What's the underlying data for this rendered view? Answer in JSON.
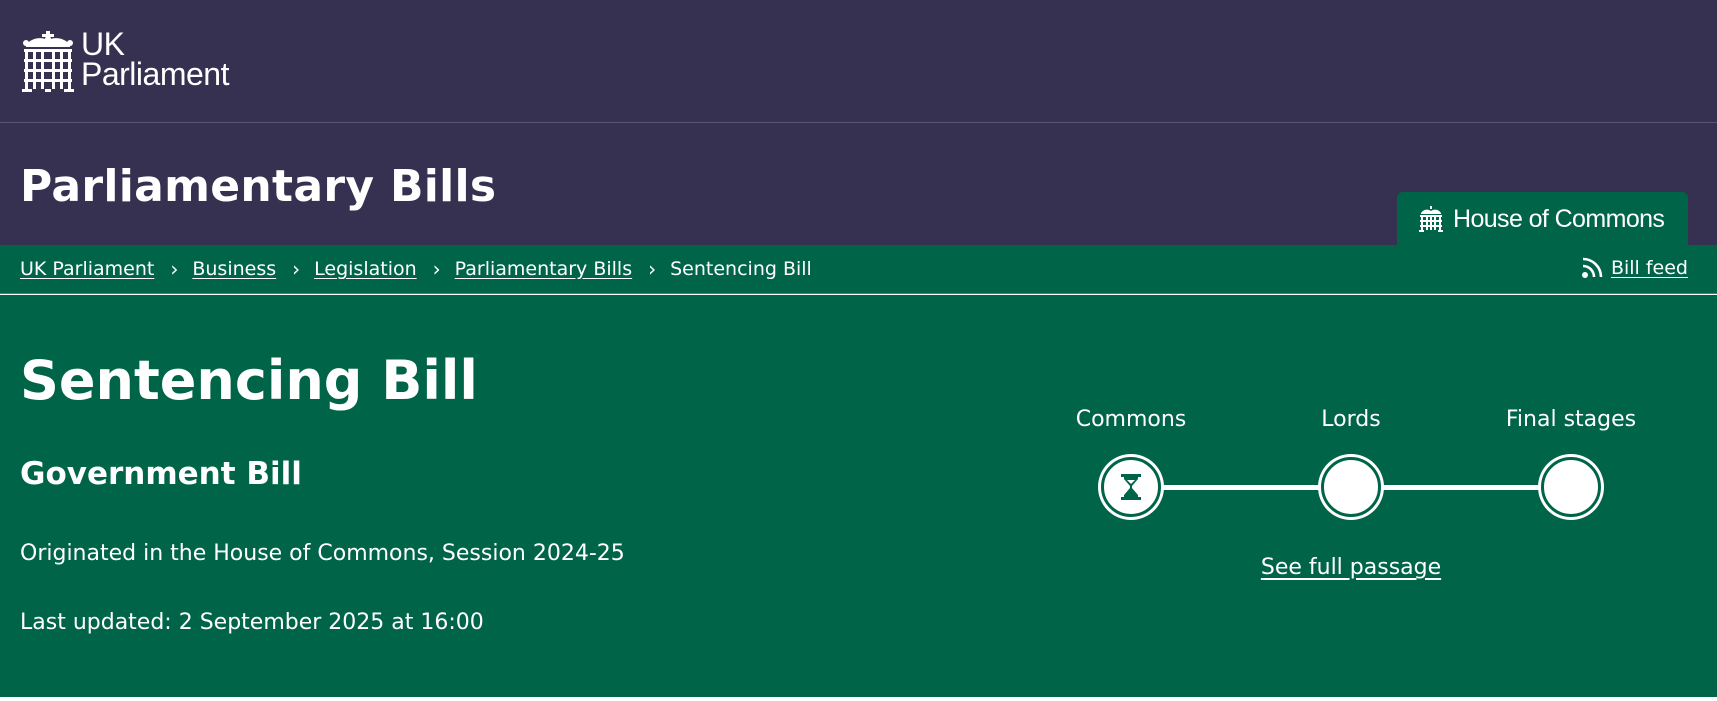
{
  "header": {
    "logo_line1": "UK",
    "logo_line2": "Parliament",
    "logo_icon": "portcullis-icon",
    "background_color": "#373151"
  },
  "section": {
    "title": "Parliamentary Bills",
    "house_tab_label": "House of Commons",
    "house_tab_icon": "portcullis-icon",
    "accent_color": "#006548"
  },
  "breadcrumb": {
    "items": [
      "UK Parliament",
      "Business",
      "Legislation",
      "Parliamentary Bills"
    ],
    "current": "Sentencing Bill",
    "separator_icon": "chevron-right-icon",
    "feed_label": "Bill feed",
    "feed_icon": "rss-icon"
  },
  "bill": {
    "title": "Sentencing Bill",
    "type": "Government Bill",
    "origin": "Originated in the House of Commons, Session 2024-25",
    "last_updated": "Last updated: 2 September 2025 at 16:00"
  },
  "progress": {
    "stages": [
      {
        "label": "Commons",
        "status": "current",
        "icon": "hourglass-icon"
      },
      {
        "label": "Lords",
        "status": "pending"
      },
      {
        "label": "Final stages",
        "status": "pending"
      }
    ],
    "full_passage_label": "See full passage"
  }
}
